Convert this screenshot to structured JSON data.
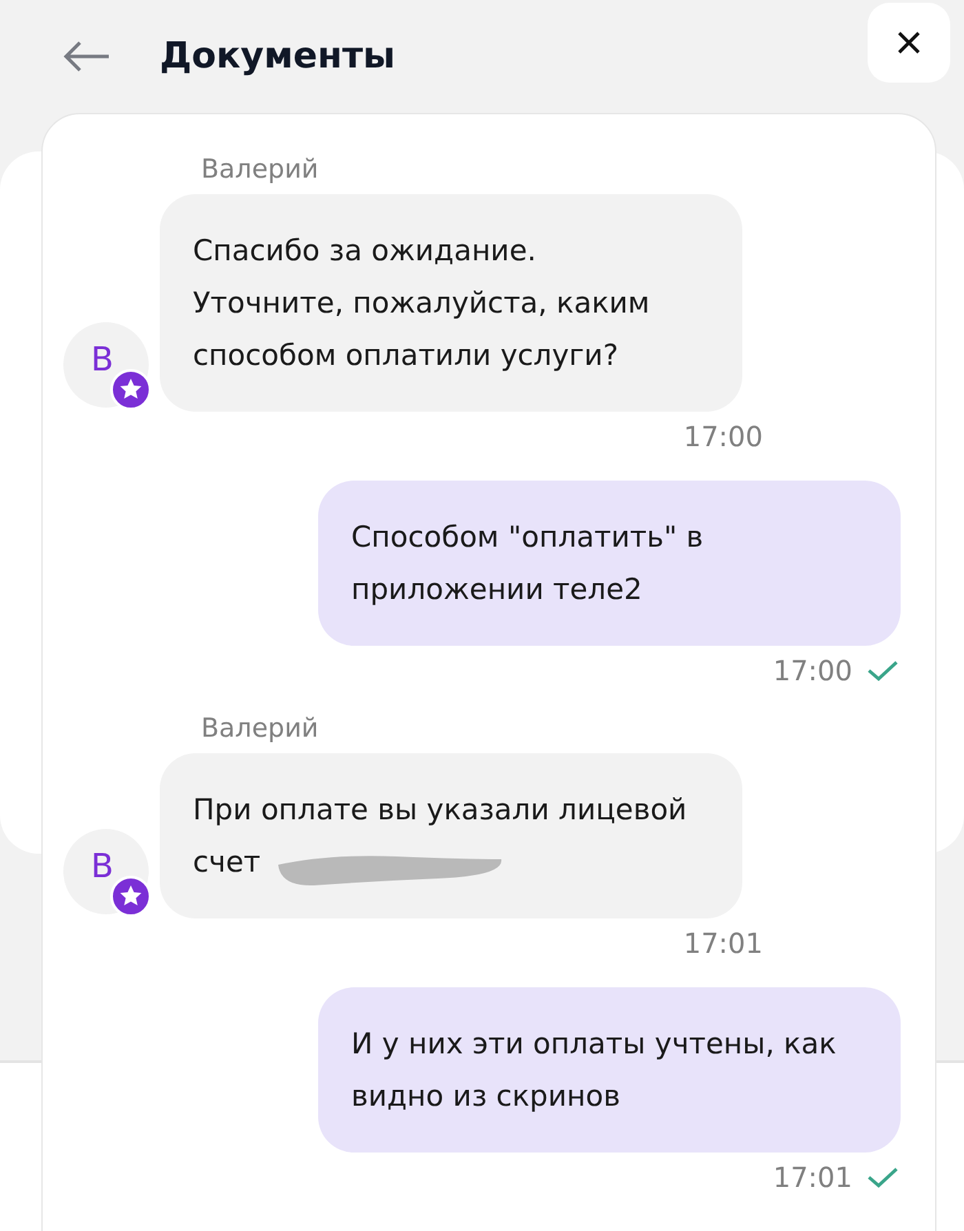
{
  "header": {
    "title": "Документы"
  },
  "messages": [
    {
      "kind": "incoming",
      "sender": "Валерий",
      "avatar": "В",
      "text": "Спасибо за ожидание.\nУточните, пожалуйста, каким\nспособом оплатили услуги?",
      "time": "17:00",
      "redacted": false
    },
    {
      "kind": "outgoing",
      "text": "Способом \"оплатить\" в\nприложении теле2",
      "time": "17:00",
      "read": true
    },
    {
      "kind": "incoming",
      "sender": "Валерий",
      "avatar": "В",
      "text": "При оплате вы указали лицевой\nсчет",
      "time": "17:01",
      "redacted": true
    },
    {
      "kind": "outgoing",
      "text": "И у них эти оплаты учтены, как\nвидно из скринов",
      "time": "17:01",
      "read": true
    }
  ]
}
